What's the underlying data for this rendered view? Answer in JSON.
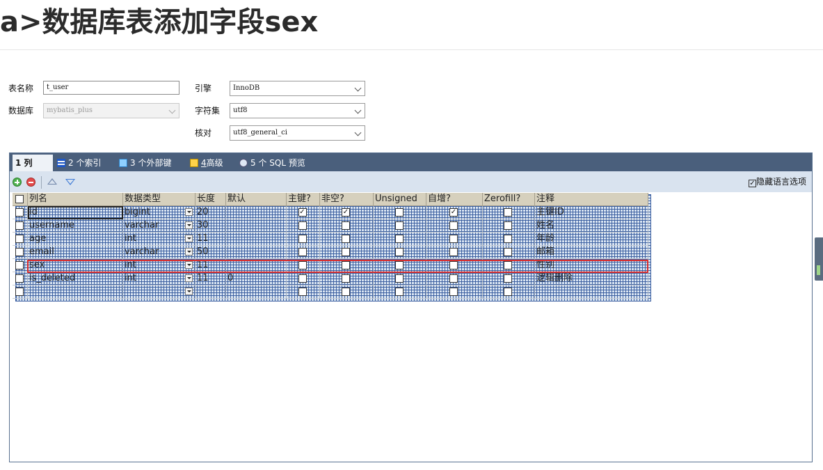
{
  "heading": "a>数据库表添加字段sex",
  "form": {
    "table_name_label": "表名称",
    "table_name_value": "t_user",
    "database_label": "数据库",
    "database_value": "mybatis_plus",
    "engine_label": "引擎",
    "engine_value": "InnoDB",
    "charset_label": "字符集",
    "charset_value": "utf8",
    "collation_label": "核对",
    "collation_value": "utf8_general_ci"
  },
  "tabs": [
    {
      "num": "1",
      "label": "列"
    },
    {
      "num": "2",
      "label": "个索引"
    },
    {
      "num": "3",
      "label": "个外部键"
    },
    {
      "num": "4",
      "label": "高级"
    },
    {
      "num": "5",
      "label": "个 SQL 预览"
    }
  ],
  "toolbar": {
    "hide_lang_label": "隐藏语言选项",
    "hide_lang_checked": true
  },
  "columns": {
    "headers": [
      "列名",
      "数据类型",
      "长度",
      "默认",
      "主键?",
      "非空?",
      "Unsigned",
      "自增?",
      "Zerofill?",
      "注释"
    ],
    "rows": [
      {
        "name": "id",
        "type": "bigint",
        "length": "20",
        "default": "",
        "pk": true,
        "not_null": true,
        "unsigned": false,
        "auto_inc": true,
        "zerofill": false,
        "comment": "主键ID"
      },
      {
        "name": "username",
        "type": "varchar",
        "length": "30",
        "default": "",
        "pk": false,
        "not_null": false,
        "unsigned": false,
        "auto_inc": false,
        "zerofill": false,
        "comment": "姓名"
      },
      {
        "name": "age",
        "type": "int",
        "length": "11",
        "default": "",
        "pk": false,
        "not_null": false,
        "unsigned": false,
        "auto_inc": false,
        "zerofill": false,
        "comment": "年龄"
      },
      {
        "name": "email",
        "type": "varchar",
        "length": "50",
        "default": "",
        "pk": false,
        "not_null": false,
        "unsigned": false,
        "auto_inc": false,
        "zerofill": false,
        "comment": "邮箱"
      },
      {
        "name": "sex",
        "type": "int",
        "length": "11",
        "default": "",
        "pk": false,
        "not_null": false,
        "unsigned": false,
        "auto_inc": false,
        "zerofill": false,
        "comment": "性别"
      },
      {
        "name": "is_deleted",
        "type": "int",
        "length": "11",
        "default": "0",
        "pk": false,
        "not_null": false,
        "unsigned": false,
        "auto_inc": false,
        "zerofill": false,
        "comment": "逻辑删除"
      },
      {
        "name": "",
        "type": "",
        "length": "",
        "default": "",
        "pk": false,
        "not_null": false,
        "unsigned": false,
        "auto_inc": false,
        "zerofill": false,
        "comment": ""
      }
    ]
  }
}
